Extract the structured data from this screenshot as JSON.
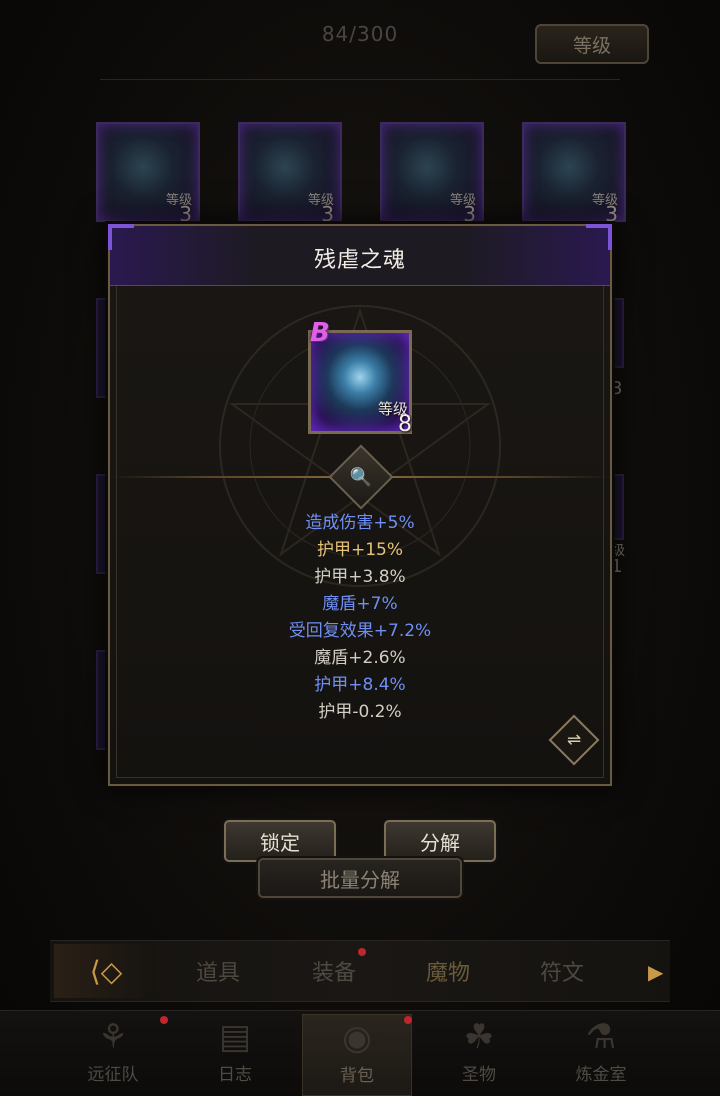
{
  "header": {
    "capacity": "84/300",
    "sort_label": "等级"
  },
  "grid_items": [
    {
      "level_label": "等级",
      "level": "3"
    },
    {
      "level_label": "等级",
      "level": "3"
    },
    {
      "level_label": "等级",
      "level": "3"
    },
    {
      "level_label": "等级",
      "level": "3"
    }
  ],
  "side_glimpse": {
    "row2_right": "3",
    "row3_right_a": "级",
    "row3_right_b": "1"
  },
  "dialog": {
    "title": "残虐之魂",
    "item": {
      "rank": "B",
      "level_label": "等级",
      "level": "8",
      "icon": "monster-soul-icon"
    },
    "stats": [
      {
        "text": "造成伤害+5%",
        "color": "#6f8ff2"
      },
      {
        "text": "护甲+15%",
        "color": "#e4c27a"
      },
      {
        "text": "护甲+3.8%",
        "color": "#d2ccc2"
      },
      {
        "text": "魔盾+7%",
        "color": "#6f8ff2"
      },
      {
        "text": "受回复效果+7.2%",
        "color": "#6f8ff2"
      },
      {
        "text": "魔盾+2.6%",
        "color": "#d2ccc2"
      },
      {
        "text": "护甲+8.4%",
        "color": "#6f8ff2"
      },
      {
        "text": "护甲-0.2%",
        "color": "#d2ccc2"
      }
    ]
  },
  "actions": {
    "lock": "锁定",
    "decompose": "分解",
    "batch_decompose": "批量分解"
  },
  "tabs": [
    "道具",
    "装备",
    "魔物",
    "符文"
  ],
  "bottom_nav": [
    {
      "label": "远征队",
      "icon": "helmet-icon"
    },
    {
      "label": "日志",
      "icon": "scroll-icon"
    },
    {
      "label": "背包",
      "icon": "bag-icon"
    },
    {
      "label": "圣物",
      "icon": "chalice-icon"
    },
    {
      "label": "炼金室",
      "icon": "alchemy-icon"
    }
  ]
}
